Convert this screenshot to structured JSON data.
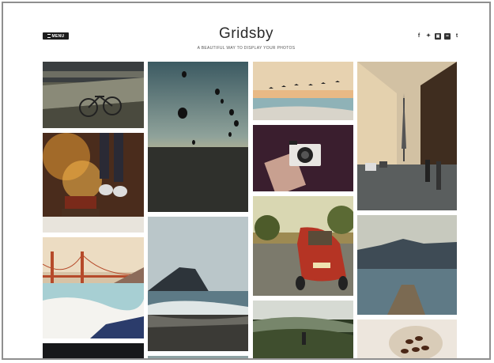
{
  "header": {
    "menu_label": "MENU",
    "site_title": "Gridsby",
    "tagline": "A BEAUTIFUL WAY TO DISPLAY YOUR PHOTOS"
  },
  "social": [
    {
      "icon": "facebook-icon",
      "glyph": "f"
    },
    {
      "icon": "twitter-icon",
      "glyph": "✦"
    },
    {
      "icon": "instagram-icon",
      "glyph": "▣"
    },
    {
      "icon": "flickr-icon",
      "glyph": "••"
    },
    {
      "icon": "tumblr-icon",
      "glyph": "t"
    }
  ],
  "photos": [
    {
      "name": "photo-bicycle-bridge"
    },
    {
      "name": "photo-hot-air-balloons"
    },
    {
      "name": "photo-birds-sunset-sea"
    },
    {
      "name": "photo-paris-street"
    },
    {
      "name": "photo-jumping-feet-books"
    },
    {
      "name": "photo-camera-hands"
    },
    {
      "name": "photo-golden-gate-bridge"
    },
    {
      "name": "photo-rock-beach"
    },
    {
      "name": "photo-red-beetle-car"
    },
    {
      "name": "photo-mountain-lake-pier"
    },
    {
      "name": "photo-dark-bottom-left"
    },
    {
      "name": "photo-green-hills-person"
    },
    {
      "name": "photo-coffee-beans"
    },
    {
      "name": "photo-bottom-column-two"
    }
  ]
}
